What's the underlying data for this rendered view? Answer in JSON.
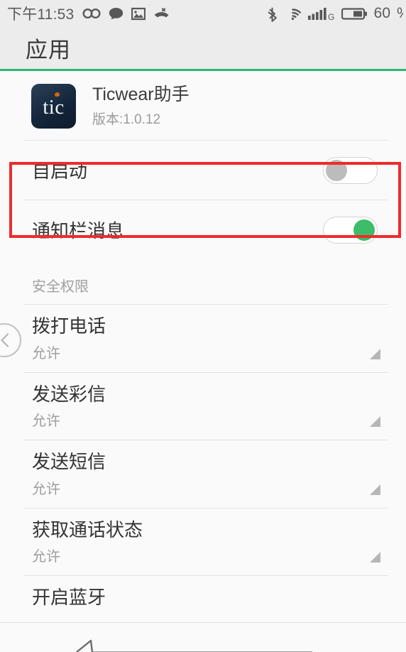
{
  "status_bar": {
    "time": "下午11:53",
    "left_icons": [
      "infinity-icon",
      "message-bubble-icon",
      "image-icon",
      "missed-call-icon"
    ],
    "right_icons": [
      "bluetooth-icon",
      "wifi-icon",
      "signal-bars-icon",
      "battery-icon"
    ],
    "signal_label": "G",
    "battery_level": "60",
    "battery_unit": "%",
    "background": "#ececec"
  },
  "header": {
    "title": "应用",
    "accent_color": "#2fb573"
  },
  "app": {
    "icon_text": "tic",
    "name": "Ticwear助手",
    "version": "版本:1.0.12"
  },
  "switches": [
    {
      "label": "自启动",
      "state": "off",
      "highlighted": true
    },
    {
      "label": "通知栏消息",
      "state": "on",
      "highlighted": false
    }
  ],
  "section": {
    "title": "安全权限"
  },
  "permissions": [
    {
      "title": "拨打电话",
      "value": "允许"
    },
    {
      "title": "发送彩信",
      "value": "允许"
    },
    {
      "title": "发送短信",
      "value": "允许"
    },
    {
      "title": "获取通话状态",
      "value": "允许"
    },
    {
      "title": "开启蓝牙",
      "value": ""
    }
  ],
  "annotation": {
    "color": "#ef2b2b",
    "target": "自启动"
  },
  "back_gesture": {
    "icon": "chevron-left-icon"
  }
}
